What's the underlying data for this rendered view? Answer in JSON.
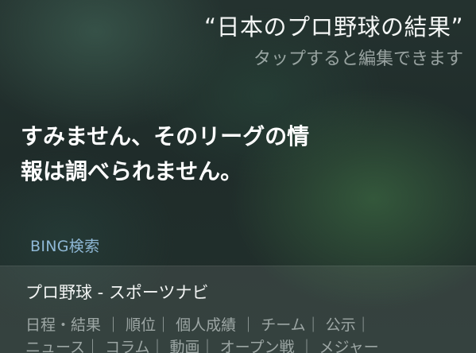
{
  "query": {
    "text": "“日本のプロ野球の結果”",
    "edit_hint": "タップすると編集できます"
  },
  "response": {
    "line1": "すみません、そのリーグの情",
    "line2": "報は調べられません。"
  },
  "search": {
    "source_label": "BING検索",
    "result": {
      "title": "プロ野球 - スポーツナビ",
      "links_row1": "日程・結果 ｜ 順位｜ 個人成績 ｜ チーム｜ 公示｜",
      "links_row2": "ニュース｜ コラム｜ 動画｜ オープン戦 ｜ メジャー"
    }
  }
}
